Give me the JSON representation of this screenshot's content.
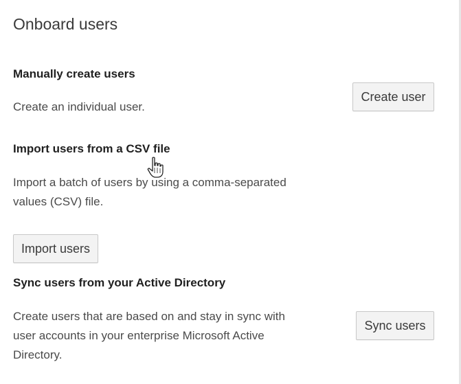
{
  "page": {
    "title": "Onboard users"
  },
  "sections": {
    "manual": {
      "heading": "Manually create users",
      "description": "Create an individual user.",
      "button_label": "Create user"
    },
    "csv": {
      "heading": "Import users from a CSV file",
      "description_line1": "Import a batch of users by using a comma-separated",
      "description_line2": "values (CSV) file.",
      "button_label": "Import users"
    },
    "sync": {
      "heading": "Sync users from your Active Directory",
      "description_line1": "Create users that are based on and stay in sync with",
      "description_line2": "user accounts in your enterprise Microsoft Active",
      "description_line3": "Directory.",
      "button_label": "Sync users"
    }
  },
  "pointer": {
    "icon": "hand-pointer-icon"
  }
}
